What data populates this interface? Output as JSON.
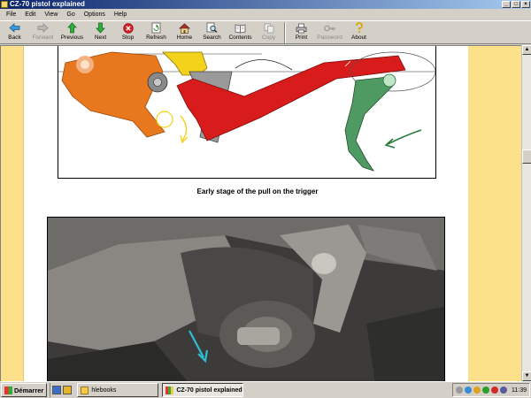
{
  "window": {
    "title": "CZ-70 pistol explained"
  },
  "menu": [
    "File",
    "Edit",
    "View",
    "Go",
    "Options",
    "Help"
  ],
  "toolbar": {
    "back": "Back",
    "forward": "Forward",
    "previous": "Previous",
    "next": "Next",
    "stop": "Stop",
    "refresh": "Refresh",
    "home": "Home",
    "search": "Search",
    "contents": "Contents",
    "copy": "Copy",
    "print": "Print",
    "password": "Password",
    "about": "About"
  },
  "content": {
    "caption": "Early stage of the pull on the trigger"
  },
  "taskbar": {
    "start": "Démarrer",
    "tasks": [
      {
        "label": "hlebooks",
        "active": false
      },
      {
        "label": "CZ-70 pistol explained",
        "active": true
      }
    ],
    "clock": "11:39"
  },
  "colors": {
    "title_bar": "#0a246a",
    "page_border": "#fde08a",
    "hammer": "#e8781e",
    "trigger_bar": "#d81c1c",
    "trigger": "#4f9a62",
    "arrow": "#2fbfd0"
  }
}
